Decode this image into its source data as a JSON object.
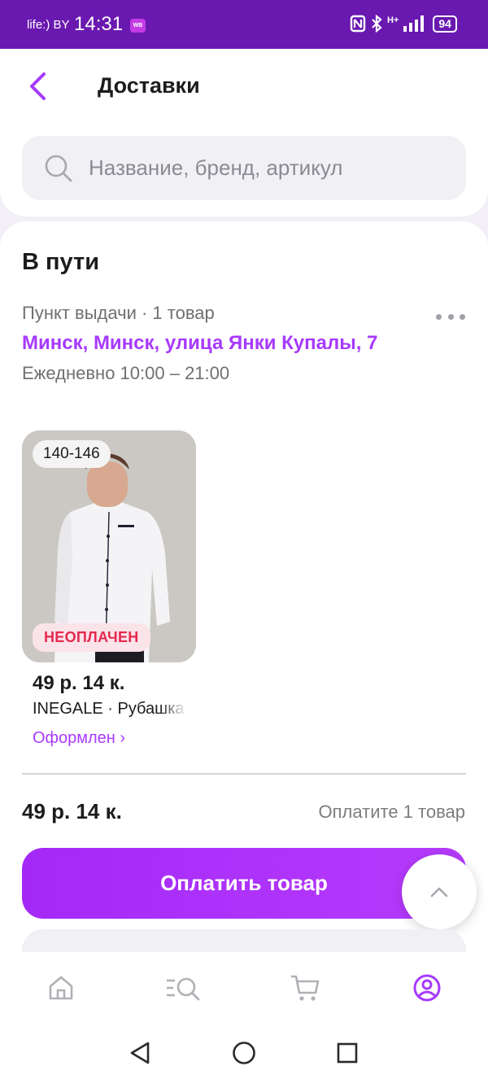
{
  "status_bar": {
    "carrier": "life:) BY",
    "time": "14:31",
    "app_badge": "WB",
    "network": "H+",
    "battery": "94"
  },
  "header": {
    "title": "Доставки"
  },
  "search": {
    "placeholder": "Название, бренд, артикул"
  },
  "delivery": {
    "status_title": "В пути",
    "pickup_meta": "Пункт выдачи · 1 товар",
    "address": "Минск, Минск, улица Янки Купалы, 7",
    "hours": "Ежедневно 10:00 – 21:00",
    "item": {
      "size": "140-146",
      "payment_badge": "НЕОПЛАЧЕН",
      "price": "49 р. 14 к.",
      "name": "INEGALE · Рубашка",
      "status": "Оформлен ›"
    },
    "total": "49 р. 14 к.",
    "total_note": "Оплатите 1 товар",
    "pay_button": "Оплатить товар"
  },
  "colors": {
    "accent": "#a73afd",
    "status_bar": "#6a19b0",
    "unpaid": "#e5294e"
  },
  "icons": {
    "back": "chevron-left-icon",
    "search": "search-icon",
    "more": "more-dots-icon",
    "scroll_top": "chevron-up-icon",
    "tabs": [
      "home-icon",
      "catalog-icon",
      "cart-icon",
      "profile-icon"
    ],
    "system_nav": [
      "back-triangle-icon",
      "home-circle-icon",
      "recents-square-icon"
    ]
  }
}
